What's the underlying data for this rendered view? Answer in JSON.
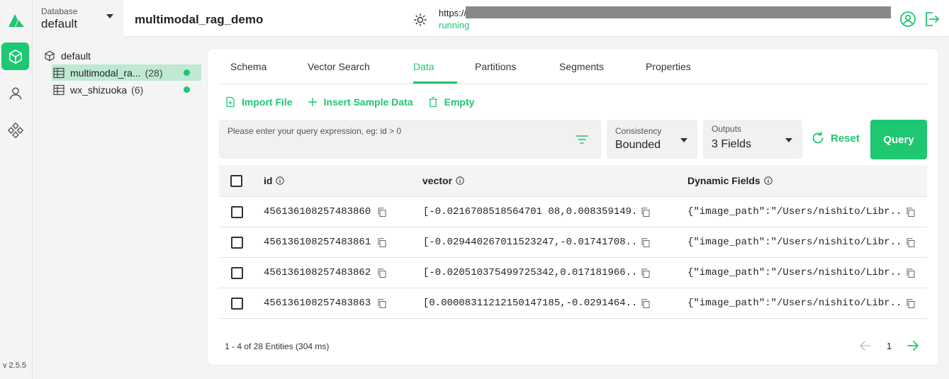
{
  "app": {
    "version": "v 2.5.5",
    "accent": "#1ec772"
  },
  "rail": {
    "items": [
      {
        "icon": "cube-icon",
        "active": true
      },
      {
        "icon": "user-icon",
        "active": false
      },
      {
        "icon": "diamond-grid-icon",
        "active": false
      }
    ]
  },
  "header": {
    "database_label": "Database",
    "database_value": "default",
    "collection_title": "multimodal_rag_demo",
    "url_prefix": "https://",
    "status": "running"
  },
  "tree": {
    "root": "default",
    "items": [
      {
        "name": "multimodal_ra...",
        "count": "(28)",
        "active": true
      },
      {
        "name": "wx_shizuoka",
        "count": "(6)",
        "active": false
      }
    ]
  },
  "tabs": [
    "Schema",
    "Vector Search",
    "Data",
    "Partitions",
    "Segments",
    "Properties"
  ],
  "active_tab": "Data",
  "toolbar": {
    "import": "Import File",
    "insert": "Insert Sample Data",
    "empty": "Empty"
  },
  "query": {
    "placeholder": "Please enter your query expression, eg: id > 0",
    "consistency_label": "Consistency",
    "consistency_value": "Bounded",
    "outputs_label": "Outputs",
    "outputs_value": "3 Fields",
    "reset": "Reset",
    "query": "Query"
  },
  "table": {
    "columns": [
      "id",
      "vector",
      "Dynamic Fields"
    ],
    "rows": [
      {
        "id": "456136108257483860",
        "vector": "[-0.0216708518564701 08,0.008359149...",
        "dynamic": "{\"image_path\":\"/Users/nishito/Libr..."
      },
      {
        "id": "456136108257483861",
        "vector": "[-0.029440267011523247,-0.01741708...",
        "dynamic": "{\"image_path\":\"/Users/nishito/Libr..."
      },
      {
        "id": "456136108257483862",
        "vector": "[-0.020510375499725342,0.017181966...",
        "dynamic": "{\"image_path\":\"/Users/nishito/Libr..."
      },
      {
        "id": "456136108257483863",
        "vector": "[0.00008311212150147185,-0.0291464...",
        "dynamic": "{\"image_path\":\"/Users/nishito/Libr..."
      }
    ]
  },
  "footer": {
    "count": "1 - 4  of 28 Entities (304 ms)",
    "page": "1"
  }
}
